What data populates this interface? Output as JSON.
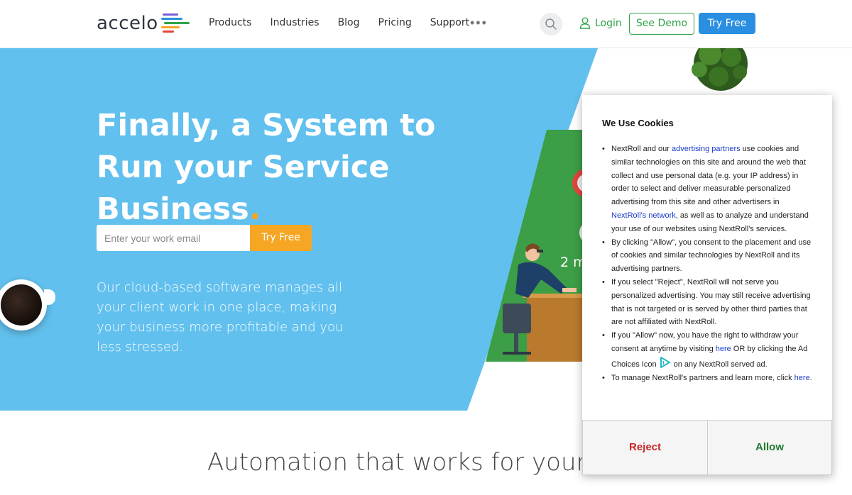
{
  "header": {
    "logo_text": "accelo",
    "nav": [
      "Products",
      "Industries",
      "Blog",
      "Pricing",
      "Support"
    ],
    "more": "•••",
    "login": "Login",
    "see_demo": "See Demo",
    "try_free": "Try Free"
  },
  "hero": {
    "headline_main": "Finally, a System to Run your Service Business",
    "headline_dot": ".",
    "email_placeholder": "Enter your work email",
    "try_free": "Try Free",
    "subtext": "Our cloud-based software manages all your client work in one place, making your business more profitable and you less stressed.",
    "illustration_text": "2 m"
  },
  "section": {
    "title": "Automation that works for your bus"
  },
  "cookie": {
    "title": "We Use Cookies",
    "item1_a": "NextRoll and our ",
    "item1_link1": "advertising partners",
    "item1_b": " use cookies and similar technologies on this site and around the web that collect and use personal data (e.g. your IP address) in order to select and deliver measurable personalized advertising from this site and other advertisers in ",
    "item1_link2": "NextRoll's network",
    "item1_c": ", as well as to analyze and understand your use of our websites using NextRoll's services.",
    "item2": "By clicking \"Allow\", you consent to the placement and use of cookies and similar technologies by NextRoll and its advertising partners.",
    "item3": "If you select \"Reject\", NextRoll will not serve you personalized advertising. You may still receive advertising that is not targeted or is served by other third parties that are not affiliated with NextRoll.",
    "item4_a": "If you \"Allow\" now, you have the right to withdraw your consent at anytime by visiting ",
    "item4_link": "here",
    "item4_b": " OR by clicking the Ad Choices Icon",
    "item4_c": "on any NextRoll served ad.",
    "item5_a": "To manage NextRoll's partners and learn more, click ",
    "item5_link": "here",
    "item5_b": ".",
    "reject": "Reject",
    "allow": "Allow"
  },
  "colors": {
    "hero_bg": "#62c0ee",
    "accent_green": "#2ea449",
    "accent_blue": "#2a8fe0",
    "accent_orange": "#f5a623",
    "reject_red": "#c62828",
    "allow_green": "#1e7a2e"
  },
  "icons": [
    "search-icon",
    "user-icon",
    "ad-choices-icon"
  ]
}
